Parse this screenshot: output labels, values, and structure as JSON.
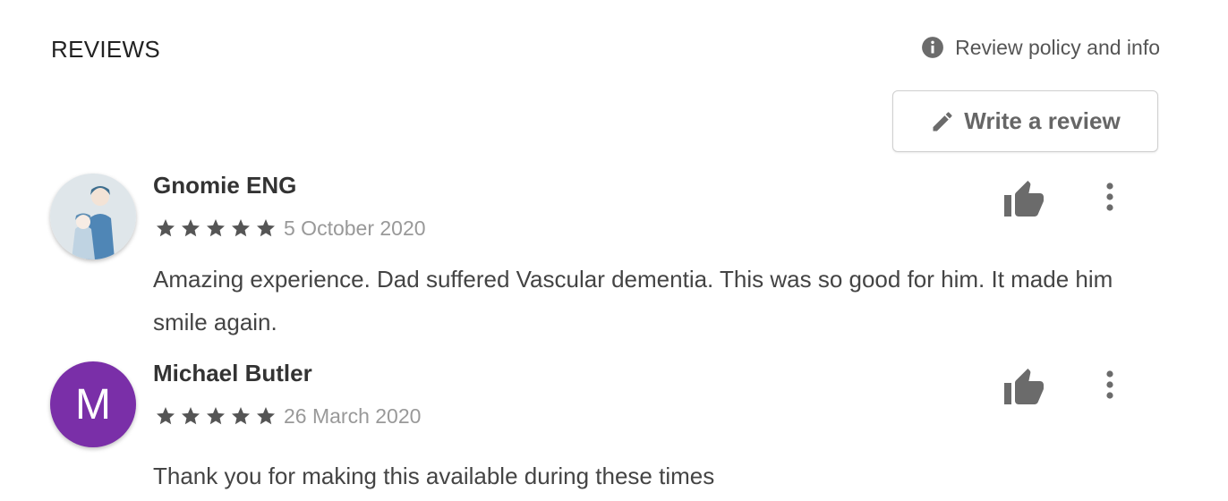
{
  "header": {
    "title": "REVIEWS",
    "policy_label": "Review policy and info",
    "write_review_label": "Write a review"
  },
  "reviews": [
    {
      "name": "Gnomie ENG",
      "rating": 5,
      "date": "5 October 2020",
      "text": "Amazing experience. Dad suffered Vascular dementia. This was so good for him. It made him smile again.",
      "avatar": "illustrated-character-avatar"
    },
    {
      "name": "Michael Butler",
      "rating": 5,
      "date": "26 March 2020",
      "text": "Thank you for making this available during these times",
      "avatar_letter": "M",
      "avatar_color": "#7a2fa8"
    }
  ],
  "icons": {
    "policy": "info-icon",
    "write": "pencil-icon",
    "like": "thumbs-up-icon",
    "more": "more-vert-icon",
    "star": "star-icon"
  },
  "colors": {
    "star": "#555555",
    "icon": "#6b6b6b"
  }
}
